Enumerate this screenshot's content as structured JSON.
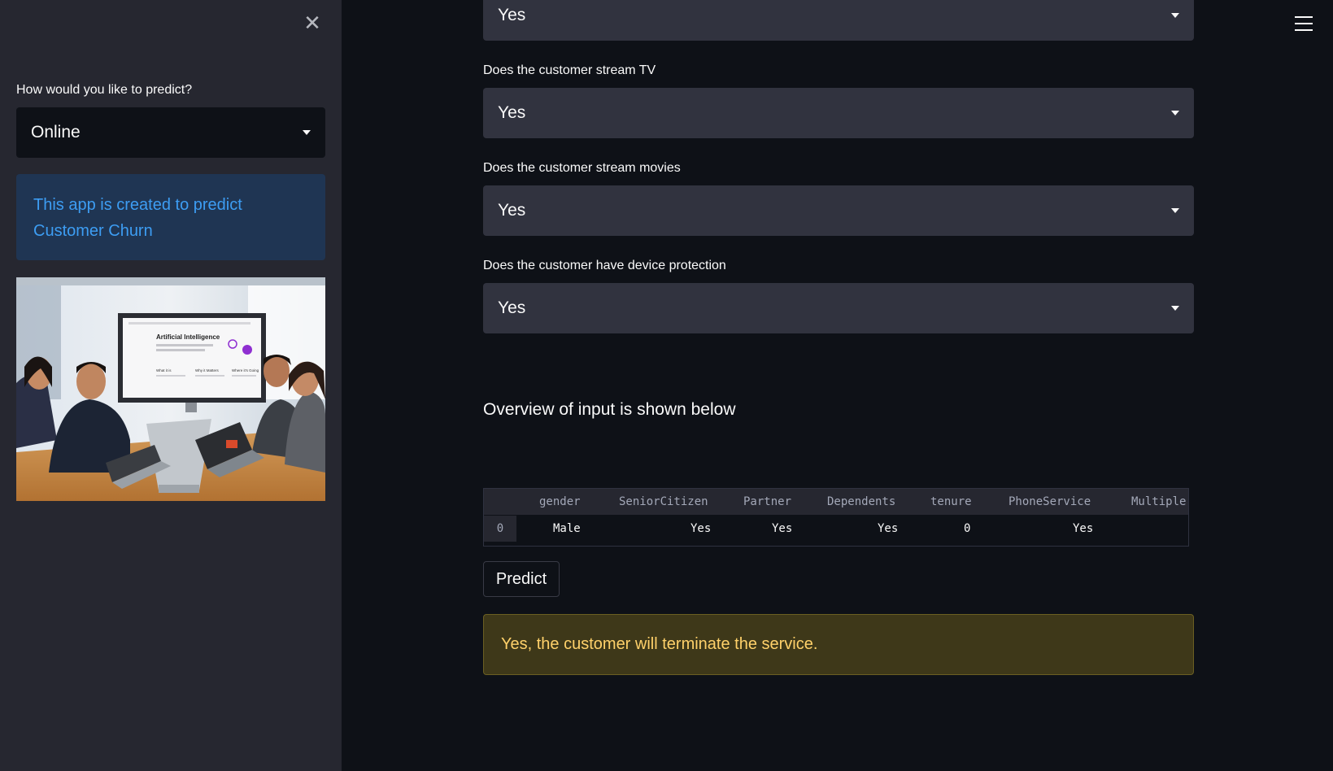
{
  "sidebar": {
    "predict_label": "How would you like to predict?",
    "predict_mode": "Online",
    "info_text": "This app is created to predict Customer Churn",
    "image": {
      "screen_title": "Artificial Intelligence",
      "screen_cols": [
        "What it is",
        "Why it Matters",
        "Where it's Going"
      ]
    }
  },
  "main": {
    "top_select_value": "Yes",
    "questions": [
      {
        "label": "Does the customer stream TV",
        "value": "Yes"
      },
      {
        "label": "Does the customer stream movies",
        "value": "Yes"
      },
      {
        "label": "Does the customer have device protection",
        "value": "Yes"
      }
    ],
    "overview_heading": "Overview of input is shown below",
    "table": {
      "columns": [
        "gender",
        "SeniorCitizen",
        "Partner",
        "Dependents",
        "tenure",
        "PhoneService",
        "Multiple"
      ],
      "rows": [
        {
          "index": "0",
          "cells": [
            "Male",
            "Yes",
            "Yes",
            "Yes",
            "0",
            "Yes",
            ""
          ]
        }
      ]
    },
    "predict_button": "Predict",
    "result_message": "Yes, the customer will terminate the service."
  },
  "colors": {
    "app_bg": "#0e1117",
    "sidebar_bg": "#262730",
    "select_bg": "#31333f",
    "info_bg": "#1f3553",
    "info_text": "#3d9df3",
    "warning_bg": "#3e3819",
    "warning_text": "#ffd16a"
  }
}
